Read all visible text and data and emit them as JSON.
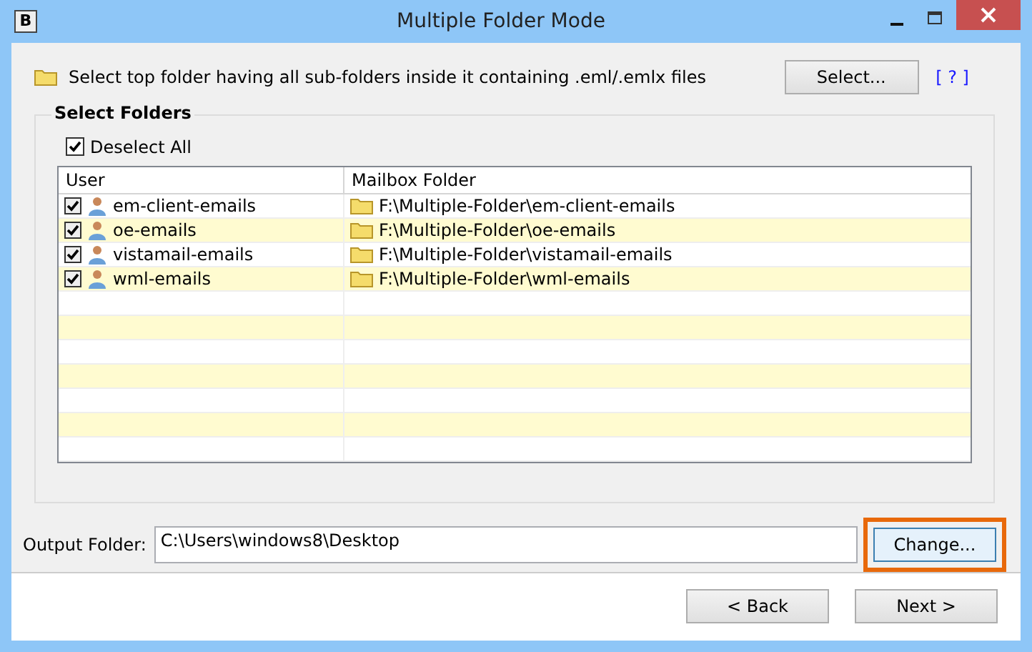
{
  "window": {
    "title": "Multiple Folder Mode",
    "app_icon_letter": "B"
  },
  "instruction": {
    "text": "Select top folder having all sub-folders inside it containing .eml/.emlx files",
    "button": "Select...",
    "help_link": "[ ? ]"
  },
  "select_folders": {
    "title": "Select Folders",
    "deselect_all": {
      "label": "Deselect All",
      "checked": true
    },
    "table": {
      "columns": [
        "User",
        "Mailbox Folder"
      ],
      "rows": [
        {
          "user": "em-client-emails",
          "folder": "F:\\Multiple-Folder\\em-client-emails",
          "checked": true
        },
        {
          "user": "oe-emails",
          "folder": "F:\\Multiple-Folder\\oe-emails",
          "checked": true
        },
        {
          "user": "vistamail-emails",
          "folder": "F:\\Multiple-Folder\\vistamail-emails",
          "checked": true
        },
        {
          "user": "wml-emails",
          "folder": "F:\\Multiple-Folder\\wml-emails",
          "checked": true
        }
      ]
    }
  },
  "output": {
    "label": "Output Folder:",
    "value": "C:\\Users\\windows8\\Desktop",
    "button": "Change...",
    "highlighted": true
  },
  "buttons": [
    "< Back",
    "Next >"
  ]
}
